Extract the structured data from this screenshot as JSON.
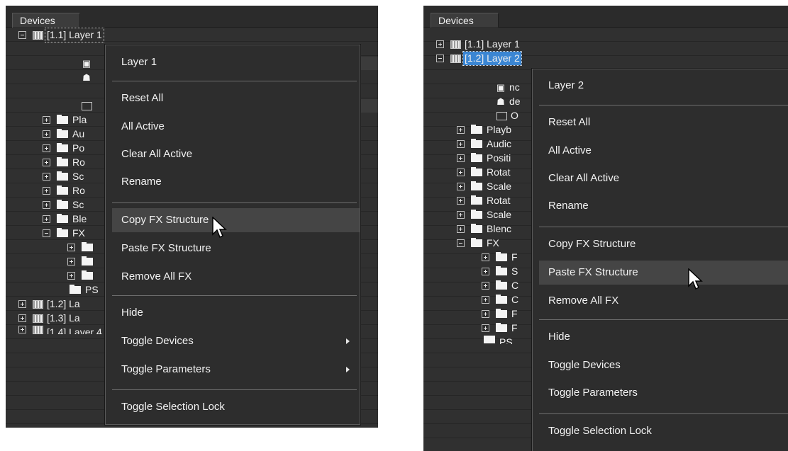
{
  "left": {
    "header": "Devices",
    "tree": [
      {
        "label": "[1.1] Layer 1"
      },
      {
        "label": "[1.2] La"
      },
      {
        "label": "[1.3] La"
      },
      {
        "label": "[1.4] Layer 4"
      }
    ],
    "folders": [
      "Pla",
      "Au",
      "Po",
      "Ro",
      "Sc",
      "Ro",
      "Sc",
      "Ble",
      "FX",
      "",
      "",
      "",
      "PS"
    ],
    "menu": {
      "title": "Layer 1",
      "items": [
        "Reset All",
        "All Active",
        "Clear All Active",
        "Rename",
        "Copy FX Structure",
        "Paste FX Structure",
        "Remove All FX",
        "Hide",
        "Toggle Devices",
        "Toggle Parameters",
        "Toggle Selection Lock"
      ],
      "highlighted": "Copy FX Structure"
    }
  },
  "right": {
    "header": "Devices",
    "tree": [
      {
        "label": "[1.1] Layer 1"
      },
      {
        "label": "[1.2] Layer 2"
      }
    ],
    "children": [
      "nc",
      "de",
      "O"
    ],
    "folders": [
      "Playb",
      "Audic",
      "Positi",
      "Rotat",
      "Scale",
      "Rotat",
      "Scale",
      "Blenc",
      "FX",
      "F",
      "S",
      "C",
      "C",
      "F",
      "F",
      "PS"
    ],
    "menu": {
      "title": "Layer 2",
      "items": [
        "Reset All",
        "All Active",
        "Clear All Active",
        "Rename",
        "Copy FX Structure",
        "Paste FX Structure",
        "Remove All FX",
        "Hide",
        "Toggle Devices",
        "Toggle Parameters",
        "Toggle Selection Lock"
      ],
      "highlighted": "Paste FX Structure"
    }
  },
  "colors": {
    "panel_bg": "#2e2e2e",
    "selection": "#3b86d3",
    "menu_bg": "#2d2d2d",
    "menu_hover": "#454545"
  },
  "icons": [
    "expand-plus-icon",
    "collapse-minus-icon",
    "folder-icon",
    "layer-icon",
    "device-icon",
    "submenu-arrow-icon",
    "mouse-cursor-icon"
  ]
}
